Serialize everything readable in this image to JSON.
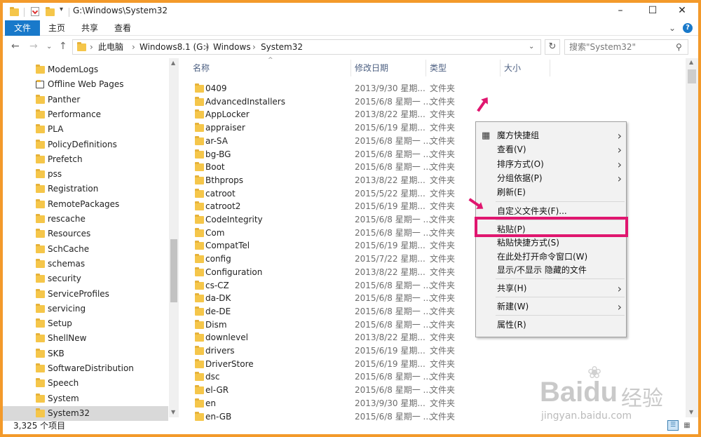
{
  "window": {
    "title": "G:\\Windows\\System32",
    "minimize": "–",
    "maximize": "☐",
    "close": "✕"
  },
  "ribbon": {
    "file_tab": "文件",
    "tabs": [
      "主页",
      "共享",
      "查看"
    ],
    "expand": "⌄",
    "help": "?"
  },
  "address": {
    "crumbs": [
      "此电脑",
      "Windows8.1 (G:)",
      "Windows",
      "System32"
    ],
    "search_placeholder": "搜索\"System32\""
  },
  "nav_pane": {
    "items": [
      "ModemLogs",
      "Offline Web Pages",
      "Panther",
      "Performance",
      "PLA",
      "PolicyDefinitions",
      "Prefetch",
      "pss",
      "Registration",
      "RemotePackages",
      "rescache",
      "Resources",
      "SchCache",
      "schemas",
      "security",
      "ServiceProfiles",
      "servicing",
      "Setup",
      "ShellNew",
      "SKB",
      "SoftwareDistribution",
      "Speech",
      "System",
      "System32"
    ],
    "selected": "System32"
  },
  "columns": {
    "name": "名称",
    "date": "修改日期",
    "type": "类型",
    "size": "大小"
  },
  "files": [
    {
      "name": "0409",
      "date": "2013/9/30 星期...",
      "type": "文件夹"
    },
    {
      "name": "AdvancedInstallers",
      "date": "2015/6/8 星期一 ...",
      "type": "文件夹"
    },
    {
      "name": "AppLocker",
      "date": "2013/8/22 星期...",
      "type": "文件夹"
    },
    {
      "name": "appraiser",
      "date": "2015/6/19 星期...",
      "type": "文件夹"
    },
    {
      "name": "ar-SA",
      "date": "2015/6/8 星期一 ...",
      "type": "文件夹"
    },
    {
      "name": "bg-BG",
      "date": "2015/6/8 星期一 ...",
      "type": "文件夹"
    },
    {
      "name": "Boot",
      "date": "2015/6/8 星期一 ...",
      "type": "文件夹"
    },
    {
      "name": "Bthprops",
      "date": "2013/8/22 星期...",
      "type": "文件夹"
    },
    {
      "name": "catroot",
      "date": "2015/5/22 星期...",
      "type": "文件夹"
    },
    {
      "name": "catroot2",
      "date": "2015/6/19 星期...",
      "type": "文件夹"
    },
    {
      "name": "CodeIntegrity",
      "date": "2015/6/8 星期一 ...",
      "type": "文件夹"
    },
    {
      "name": "Com",
      "date": "2015/6/8 星期一 ...",
      "type": "文件夹"
    },
    {
      "name": "CompatTel",
      "date": "2015/6/19 星期...",
      "type": "文件夹"
    },
    {
      "name": "config",
      "date": "2015/7/22 星期...",
      "type": "文件夹"
    },
    {
      "name": "Configuration",
      "date": "2013/8/22 星期...",
      "type": "文件夹"
    },
    {
      "name": "cs-CZ",
      "date": "2015/6/8 星期一 ...",
      "type": "文件夹"
    },
    {
      "name": "da-DK",
      "date": "2015/6/8 星期一 ...",
      "type": "文件夹"
    },
    {
      "name": "de-DE",
      "date": "2015/6/8 星期一 ...",
      "type": "文件夹"
    },
    {
      "name": "Dism",
      "date": "2015/6/8 星期一 ...",
      "type": "文件夹"
    },
    {
      "name": "downlevel",
      "date": "2013/8/22 星期...",
      "type": "文件夹"
    },
    {
      "name": "drivers",
      "date": "2015/6/19 星期...",
      "type": "文件夹"
    },
    {
      "name": "DriverStore",
      "date": "2015/6/19 星期...",
      "type": "文件夹"
    },
    {
      "name": "dsc",
      "date": "2015/6/8 星期一 ...",
      "type": "文件夹"
    },
    {
      "name": "el-GR",
      "date": "2015/6/8 星期一 ...",
      "type": "文件夹"
    },
    {
      "name": "en",
      "date": "2013/9/30 星期...",
      "type": "文件夹"
    },
    {
      "name": "en-GB",
      "date": "2015/6/8 星期一 ...",
      "type": "文件夹"
    }
  ],
  "context_menu": {
    "groups": [
      [
        {
          "label": "魔方快捷组",
          "submenu": true
        },
        {
          "label": "查看(V)",
          "submenu": true
        },
        {
          "label": "排序方式(O)",
          "submenu": true
        },
        {
          "label": "分组依据(P)",
          "submenu": true
        },
        {
          "label": "刷新(E)",
          "submenu": false
        }
      ],
      [
        {
          "label": "自定义文件夹(F)...",
          "submenu": false
        }
      ],
      [
        {
          "label": "粘贴(P)",
          "submenu": false
        },
        {
          "label": "粘贴快捷方式(S)",
          "submenu": false
        },
        {
          "label": "在此处打开命令窗口(W)",
          "submenu": false
        },
        {
          "label": "显示/不显示 隐藏的文件",
          "submenu": false
        }
      ],
      [
        {
          "label": "共享(H)",
          "submenu": true
        }
      ],
      [
        {
          "label": "新建(W)",
          "submenu": true
        }
      ],
      [
        {
          "label": "属性(R)",
          "submenu": false
        }
      ]
    ],
    "highlighted": "粘贴(P)"
  },
  "status": {
    "item_count": "3,325 个项目"
  },
  "watermark": {
    "brand": "Baidu",
    "brand_cn": "经验",
    "url": "jingyan.baidu.com"
  },
  "colors": {
    "border": "#f39a2b",
    "accent": "#1979ca",
    "folder": "#f5c64a",
    "highlight": "#e0166f"
  }
}
